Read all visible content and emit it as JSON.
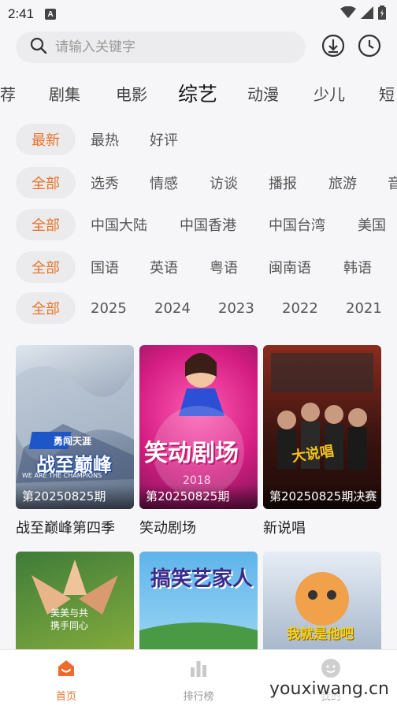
{
  "status_bar": {
    "time": "2:41",
    "a_icon": "A"
  },
  "search": {
    "placeholder": "请输入关键字"
  },
  "category_tabs": [
    "荐",
    "剧集",
    "电影",
    "综艺",
    "动漫",
    "少儿",
    "短"
  ],
  "active_category": "综艺",
  "filters": {
    "sort": [
      "最新",
      "最热",
      "好评"
    ],
    "type": [
      "全部",
      "选秀",
      "情感",
      "访谈",
      "播报",
      "旅游",
      "音"
    ],
    "region": [
      "全部",
      "中国大陆",
      "中国香港",
      "中国台湾",
      "美国"
    ],
    "language": [
      "全部",
      "国语",
      "英语",
      "粤语",
      "闽南语",
      "韩语"
    ],
    "year": [
      "全部",
      "2025",
      "2024",
      "2023",
      "2022",
      "2021"
    ]
  },
  "cards": [
    {
      "title": "战至巅峰第四季",
      "episode": "第20250825期",
      "poster_text": "战至巅峰",
      "poster_sub": "WE ARE THE CHAMPIONS",
      "poster_badge": "勇闯天涯",
      "colors": [
        "#c9d3df",
        "#7e8fa8"
      ]
    },
    {
      "title": "笑动剧场",
      "episode": "第20250825期",
      "poster_text": "笑动剧场",
      "poster_sub": "2018",
      "colors": [
        "#e0339a",
        "#8c1e6a"
      ]
    },
    {
      "title": "新说唱",
      "episode": "第20250825期决赛",
      "poster_text": "大说唱",
      "colors": [
        "#5a1a14",
        "#2a0d0a"
      ]
    },
    {
      "title": "",
      "episode": "",
      "poster_text": "美美与共 携手同心",
      "colors": [
        "#4f9a4a",
        "#8aa336"
      ]
    },
    {
      "title": "",
      "episode": "",
      "poster_text": "搞笑艺家人",
      "colors": [
        "#5aa9e0",
        "#7bc46a"
      ]
    },
    {
      "title": "",
      "episode": "",
      "poster_text": "我就是他吧",
      "colors": [
        "#c8d6e6",
        "#7d8ea5"
      ]
    }
  ],
  "bottom_nav": [
    {
      "label": "首页",
      "icon": "home-icon",
      "active": true
    },
    {
      "label": "排行榜",
      "icon": "ranking-icon",
      "active": false
    },
    {
      "label": "我的",
      "icon": "profile-icon",
      "active": false
    }
  ],
  "watermark": "youxiwang.cn",
  "accent_color": "#e8742a"
}
